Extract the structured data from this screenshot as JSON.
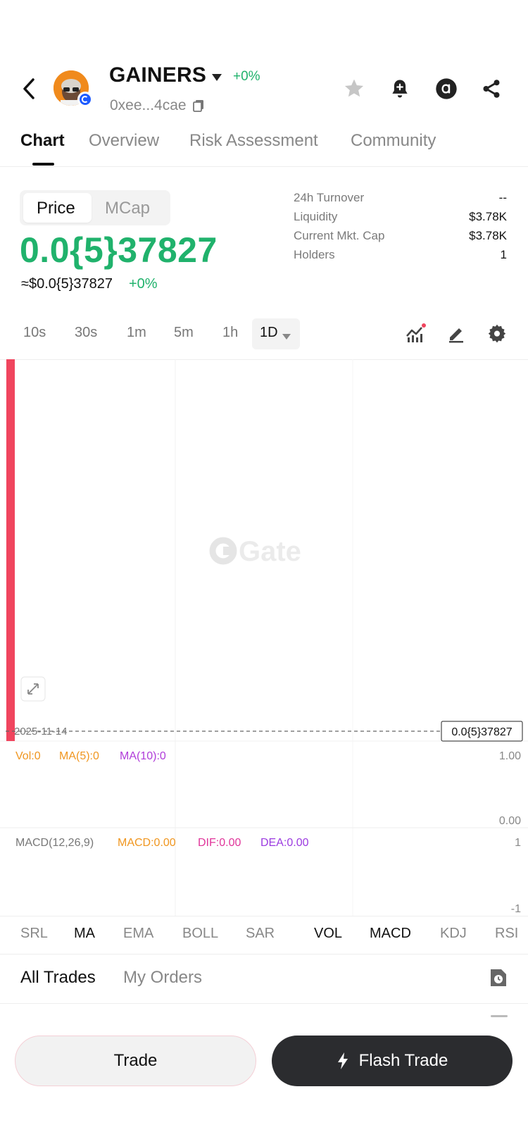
{
  "header": {
    "token_name": "GAINERS",
    "change": "+0%",
    "address": "0xee...4cae"
  },
  "tabs": [
    {
      "label": "Chart",
      "active": true
    },
    {
      "label": "Overview",
      "active": false
    },
    {
      "label": "Risk Assessment",
      "active": false
    },
    {
      "label": "Community",
      "active": false
    }
  ],
  "price_toggle": {
    "price_label": "Price",
    "mcap_label": "MCap"
  },
  "price": {
    "value": "0.0{5}37827",
    "usd": "≈$0.0{5}37827",
    "change": "+0%"
  },
  "stats": [
    {
      "label": "24h Turnover",
      "value": "--"
    },
    {
      "label": "Liquidity",
      "value": "$3.78K"
    },
    {
      "label": "Current Mkt. Cap",
      "value": "$3.78K"
    },
    {
      "label": "Holders",
      "value": "1"
    }
  ],
  "intervals": [
    "10s",
    "30s",
    "1m",
    "5m",
    "1h",
    "1D"
  ],
  "selected_interval": "1D",
  "chart": {
    "watermark": "Gate",
    "date_label": "2025-11-14",
    "last_price_label": "0.0{5}37827",
    "vol_legend": {
      "vol": "Vol:0",
      "ma5": "MA(5):0",
      "ma10": "MA(10):0"
    },
    "vol_axis_top": "1.00",
    "vol_axis_bottom": "0.00",
    "macd_legend": {
      "name": "MACD(12,26,9)",
      "macd": "MACD:0.00",
      "dif": "DIF:0.00",
      "dea": "DEA:0.00"
    },
    "macd_axis_top": "1",
    "macd_axis_bottom": "-1",
    "colors": {
      "candle": "#f0455e",
      "vol": "#f0961f",
      "ma5": "#f0961f",
      "ma10": "#b03cd9",
      "dif": "#e0359a",
      "dea": "#9b3ae0"
    }
  },
  "indicators": [
    {
      "label": "SRL",
      "on": false
    },
    {
      "label": "MA",
      "on": true
    },
    {
      "label": "EMA",
      "on": false
    },
    {
      "label": "BOLL",
      "on": false
    },
    {
      "label": "SAR",
      "on": false
    },
    {
      "label": "VOL",
      "on": true
    },
    {
      "label": "MACD",
      "on": true
    },
    {
      "label": "KDJ",
      "on": false
    },
    {
      "label": "RSI",
      "on": false
    }
  ],
  "trades_tabs": [
    {
      "label": "All Trades",
      "active": true
    },
    {
      "label": "My Orders",
      "active": false
    }
  ],
  "buttons": {
    "trade": "Trade",
    "flash_trade": "Flash Trade"
  },
  "theme": {
    "green": "#20b26c",
    "red": "#f0455e",
    "dark": "#2b2c2f"
  }
}
